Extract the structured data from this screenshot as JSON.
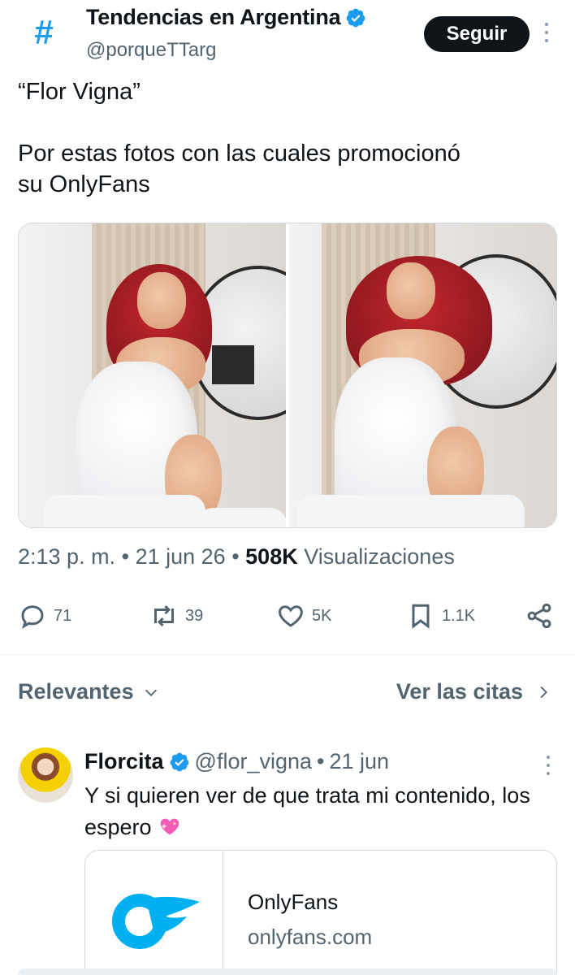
{
  "tweet": {
    "author": {
      "name": "Tendencias en Argentina",
      "handle": "@porqueTTarg",
      "avatar_icon": "hashtag-icon",
      "verified": true
    },
    "follow_label": "Seguir",
    "text": "“Flor Vigna”\n\nPor estas fotos con las cuales promocionó\nsu OnlyFans",
    "media_count": 2,
    "meta": {
      "time": "2:13 p. m.",
      "sep1": "•",
      "date": "21 jun 26",
      "sep2": "•",
      "views_count": "508K",
      "views_label": "Visualizaciones"
    },
    "actions": {
      "replies": "71",
      "retweets": "39",
      "likes": "5K",
      "bookmarks": "1.1K"
    }
  },
  "sort": {
    "left_label": "Relevantes",
    "right_label": "Ver las citas"
  },
  "reply": {
    "name": "Florcita",
    "handle": "@flor_vigna",
    "sep": "•",
    "date": "21 jun",
    "text": "Y si quieren ver de que trata mi contenido, los espero",
    "emoji": "sparkling-heart-icon",
    "card": {
      "title": "OnlyFans",
      "domain": "onlyfans.com"
    }
  },
  "colors": {
    "accent": "#1d9bf0",
    "text_secondary": "#536471",
    "follow_bg": "#0f1419"
  }
}
